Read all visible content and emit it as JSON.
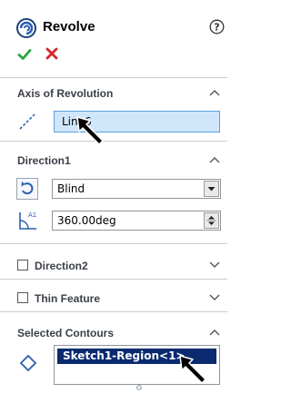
{
  "header": {
    "title": "Revolve",
    "icons": {
      "feature": "revolve-icon",
      "help": "help-icon",
      "ok": "checkmark-icon",
      "cancel": "close-icon"
    },
    "colors": {
      "ok": "#2fa33a",
      "cancel": "#d4282a",
      "accent": "#2a5fae"
    }
  },
  "axis_of_revolution": {
    "title": "Axis of Revolution",
    "value": "Line6",
    "field_color": "#cfe6fb"
  },
  "direction1": {
    "title": "Direction1",
    "end_condition": "Blind",
    "angle": "360.00deg",
    "angle_icon_label": "A1"
  },
  "direction2": {
    "title": "Direction2",
    "checked": false
  },
  "thin_feature": {
    "title": "Thin Feature",
    "checked": false
  },
  "selected_contours": {
    "title": "Selected Contours",
    "items": [
      "Sketch1-Region<1>"
    ],
    "selection_color": "#0b2a6f"
  }
}
